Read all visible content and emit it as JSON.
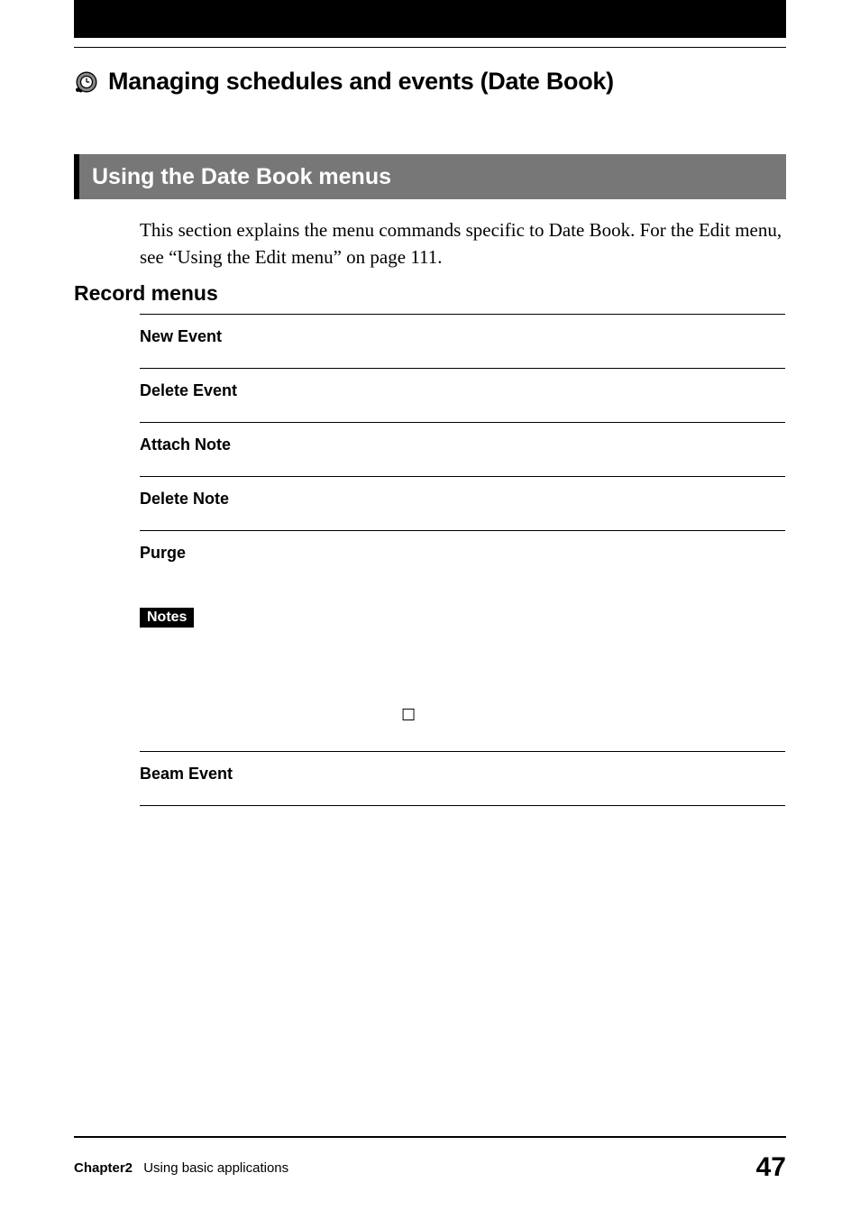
{
  "header": {
    "section_title": "Managing schedules and events (Date Book)",
    "icon": "date-book-icon"
  },
  "banner": {
    "title": "Using the Date Book menus"
  },
  "intro": "This section explains the menu commands specific to Date Book. For the Edit menu, see “Using the Edit menu” on page 111.",
  "subheading": "Record menus",
  "menu_items": [
    {
      "label": "New Event"
    },
    {
      "label": "Delete Event"
    },
    {
      "label": "Attach Note"
    },
    {
      "label": "Delete Note"
    },
    {
      "label": "Purge",
      "has_notes": true,
      "notes_label": "Notes",
      "checkbox": "☐"
    },
    {
      "label": "Beam Event"
    }
  ],
  "footer": {
    "chapter": "Chapter2",
    "desc": "Using basic applications",
    "page_number": "47"
  }
}
